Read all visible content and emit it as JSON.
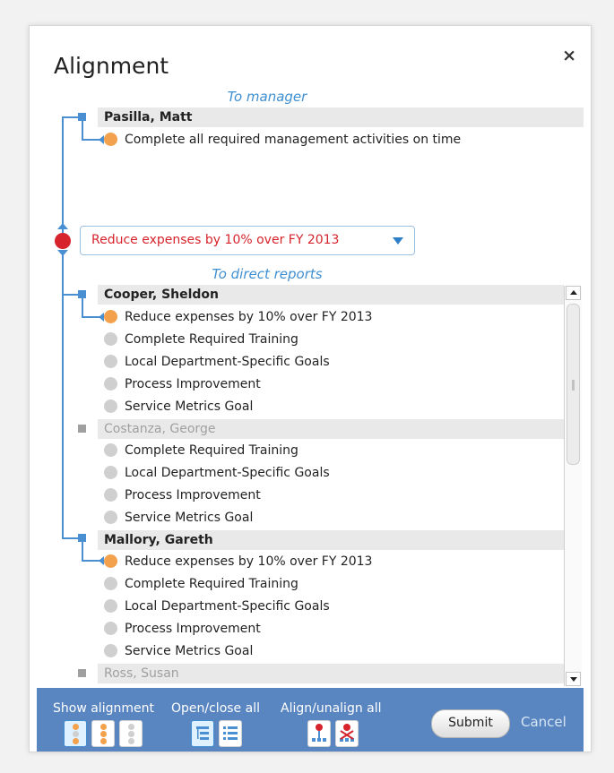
{
  "dialog": {
    "title": "Alignment",
    "close_label": "×"
  },
  "to_manager_label": "To manager",
  "to_direct_reports_label": "To direct reports",
  "manager": {
    "name": "Pasilla, Matt",
    "goal": "Complete all required management activities on time"
  },
  "selected_goal": {
    "value": "Reduce expenses by 10% over FY 2013"
  },
  "direct_reports": [
    {
      "name": "Cooper, Sheldon",
      "goals": [
        "Reduce expenses by 10% over FY 2013",
        "Complete Required Training",
        "Local Department-Specific Goals",
        "Process Improvement",
        "Service Metrics Goal"
      ]
    },
    {
      "name": "Costanza, George",
      "goals": [
        "Complete Required Training",
        "Local Department-Specific Goals",
        "Process Improvement",
        "Service Metrics Goal"
      ]
    },
    {
      "name": "Mallory, Gareth",
      "goals": [
        "Reduce expenses by 10% over FY 2013",
        "Complete Required Training",
        "Local Department-Specific Goals",
        "Process Improvement",
        "Service Metrics Goal"
      ]
    },
    {
      "name": "Ross, Susan",
      "goals": []
    }
  ],
  "footer": {
    "show_alignment_label": "Show alignment",
    "open_close_label": "Open/close all",
    "align_unalign_label": "Align/unalign all",
    "submit_label": "Submit",
    "cancel_label": "Cancel"
  },
  "colors": {
    "accent": "#4a8fd1",
    "aligned_dot": "#f3a14c",
    "unaligned_dot": "#cfcfcf",
    "selected_goal_dot": "#d7232c",
    "footer_bg": "#5985c1"
  }
}
